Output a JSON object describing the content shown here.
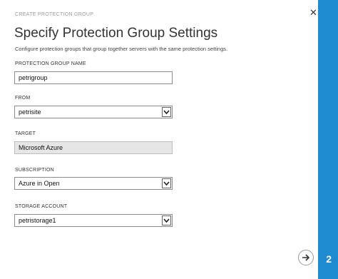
{
  "dialog": {
    "header": "CREATE PROTECTION GROUP",
    "title": "Specify Protection Group Settings",
    "subtitle": "Configure protection groups that group together servers with the same protection settings.",
    "step": "2"
  },
  "fields": {
    "name": {
      "label": "PROTECTION GROUP NAME",
      "value": "petrigroup"
    },
    "from": {
      "label": "FROM",
      "value": "petrisite"
    },
    "target": {
      "label": "TARGET",
      "value": "Microsoft Azure"
    },
    "subscription": {
      "label": "SUBSCRIPTION",
      "value": "Azure in Open"
    },
    "storage": {
      "label": "STORAGE ACCOUNT",
      "value": "petristorage1"
    }
  },
  "icons": {
    "close": "close-icon",
    "next": "arrow-right-icon",
    "dropdown": "chevron-down-icon"
  },
  "colors": {
    "accent": "#1e8bd0",
    "disabled_bg": "#e6e6e6"
  }
}
